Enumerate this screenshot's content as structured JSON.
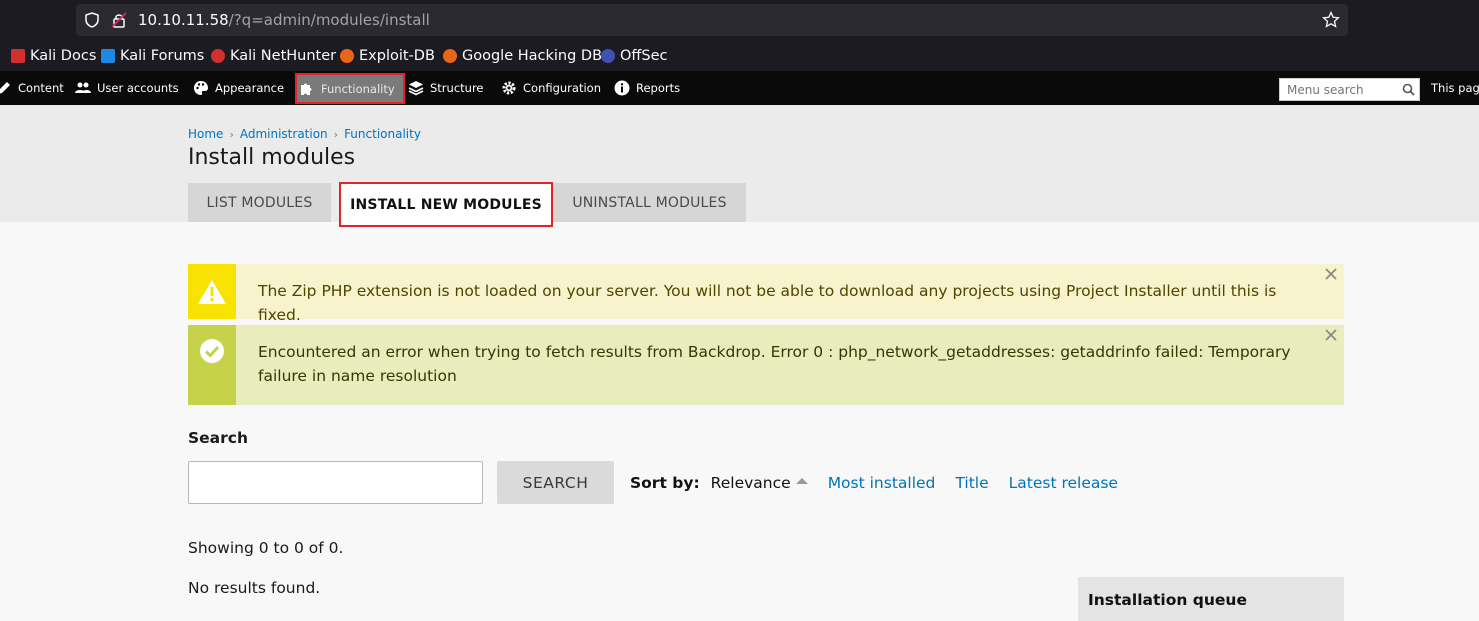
{
  "browser": {
    "url_host": "10.10.11.58",
    "url_path": "/?q=admin/modules/install",
    "bookmarks": [
      {
        "label": "Kali Docs",
        "icon": "kali-docs-icon",
        "color": "#d32f2f"
      },
      {
        "label": "Kali Forums",
        "icon": "kali-forums-icon",
        "color": "#1e88e5"
      },
      {
        "label": "Kali NetHunter",
        "icon": "kali-nethunter-icon",
        "color": "#d32f2f"
      },
      {
        "label": "Exploit-DB",
        "icon": "exploit-db-icon",
        "color": "#e8651a"
      },
      {
        "label": "Google Hacking DB",
        "icon": "ghdb-icon",
        "color": "#e8651a"
      },
      {
        "label": "OffSec",
        "icon": "offsec-icon",
        "color": "#3f51b5"
      }
    ]
  },
  "admin_bar": {
    "items": [
      {
        "label": "Content",
        "icon": "pencil-icon"
      },
      {
        "label": "User accounts",
        "icon": "users-icon"
      },
      {
        "label": "Appearance",
        "icon": "palette-icon"
      },
      {
        "label": "Functionality",
        "icon": "puzzle-icon",
        "active": true
      },
      {
        "label": "Structure",
        "icon": "layers-icon"
      },
      {
        "label": "Configuration",
        "icon": "gear-icon"
      },
      {
        "label": "Reports",
        "icon": "info-icon"
      }
    ],
    "search_placeholder": "Menu search",
    "this_page": "This page"
  },
  "breadcrumb": [
    "Home",
    "Administration",
    "Functionality"
  ],
  "page_title": "Install modules",
  "tabs": [
    {
      "label": "LIST MODULES",
      "active": false
    },
    {
      "label": "INSTALL NEW MODULES",
      "active": true
    },
    {
      "label": "UNINSTALL MODULES",
      "active": false
    }
  ],
  "messages": {
    "warning": "The Zip PHP extension is not loaded on your server. You will not be able to download any projects using Project Installer until this is fixed.",
    "status": "Encountered an error when trying to fetch results from Backdrop. Error 0 : php_network_getaddresses: getaddrinfo failed: Temporary failure in name resolution"
  },
  "search": {
    "label": "Search",
    "value": "",
    "button": "SEARCH"
  },
  "sort": {
    "label": "Sort by:",
    "current": "Relevance",
    "options": [
      "Most installed",
      "Title",
      "Latest release"
    ]
  },
  "results": {
    "showing": "Showing 0 to 0 of 0.",
    "empty": "No results found."
  },
  "queue_title": "Installation queue",
  "colors": {
    "accent_link": "#0074bd",
    "highlight_border": "#e0242a",
    "warning_bar": "#f8e201",
    "status_bar": "#c7d24b"
  }
}
